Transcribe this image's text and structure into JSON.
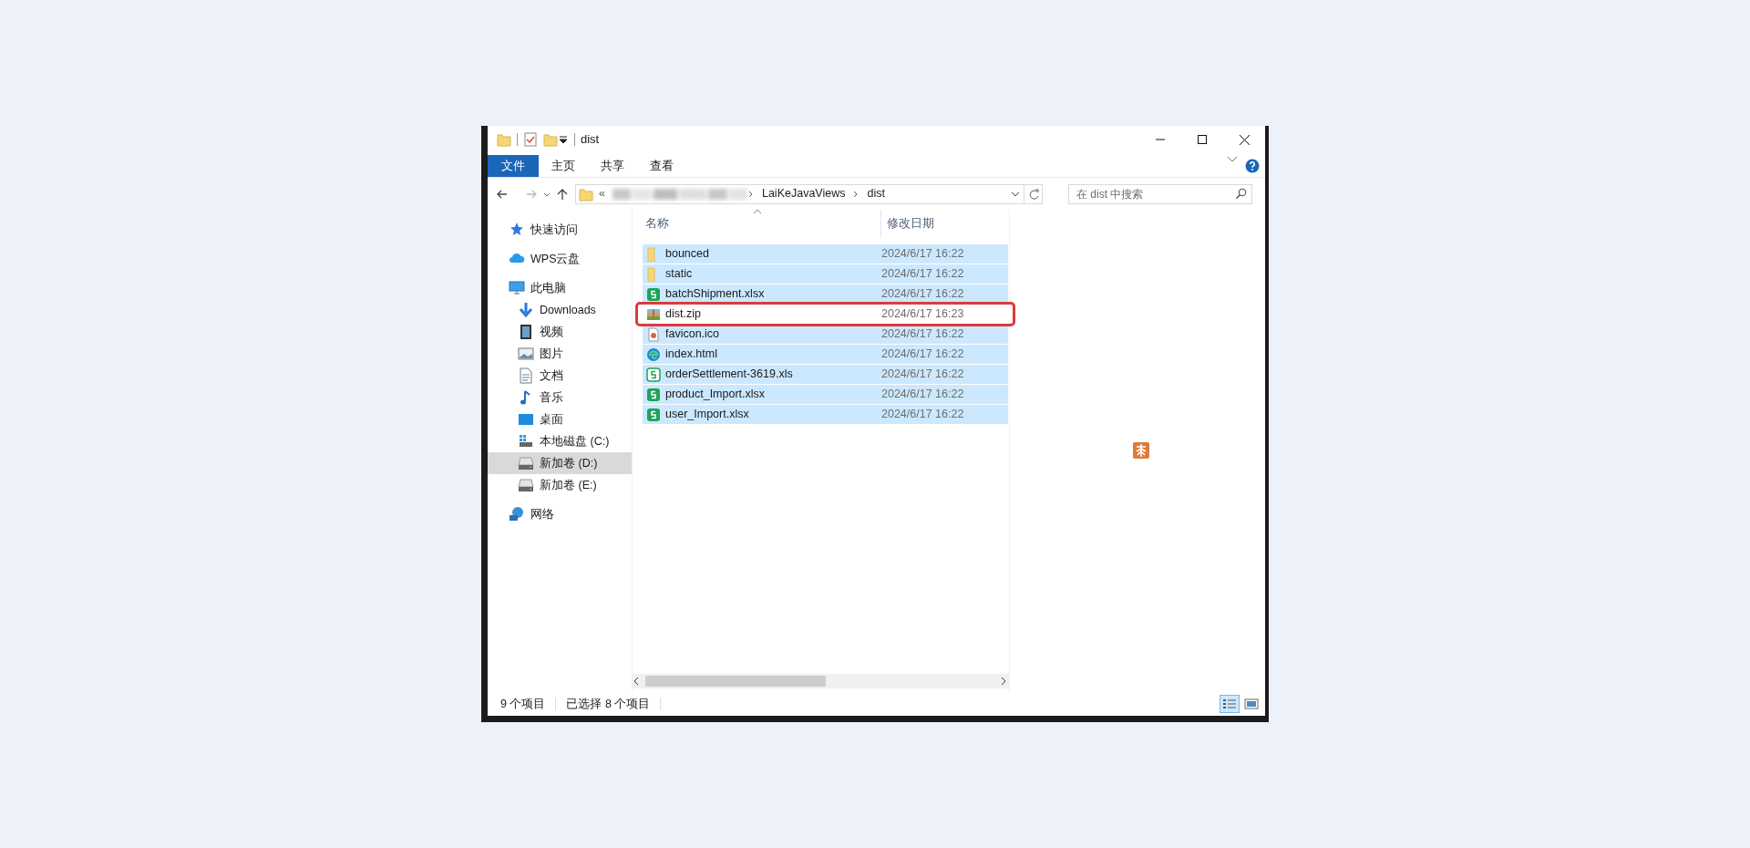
{
  "window": {
    "title": "dist"
  },
  "ribbon_tabs": [
    {
      "label": "文件",
      "kind": "file"
    },
    {
      "label": "主页",
      "kind": "tab"
    },
    {
      "label": "共享",
      "kind": "tab"
    },
    {
      "label": "查看",
      "kind": "tab"
    }
  ],
  "address": [
    {
      "kind": "overflow",
      "label": "«"
    },
    {
      "kind": "redacted"
    },
    {
      "kind": "folder",
      "label": "LaiKeJavaViews"
    },
    {
      "kind": "folder",
      "label": "dist"
    }
  ],
  "search": {
    "placeholder": "在 dist 中搜索"
  },
  "sidebar": {
    "items": [
      {
        "label": "快速访问",
        "kind": "star",
        "selected": false
      },
      {
        "label": "WPS云盘",
        "kind": "cloud",
        "selected": false
      },
      {
        "label": "此电脑",
        "kind": "pc",
        "selected": false,
        "children": [
          {
            "label": "Downloads",
            "kind": "download",
            "selected": false
          },
          {
            "label": "视频",
            "kind": "video",
            "selected": false
          },
          {
            "label": "图片",
            "kind": "picture",
            "selected": false
          },
          {
            "label": "文档",
            "kind": "doc",
            "selected": false
          },
          {
            "label": "音乐",
            "kind": "music",
            "selected": false
          },
          {
            "label": "桌面",
            "kind": "desktop",
            "selected": false
          },
          {
            "label": "本地磁盘 (C:)",
            "kind": "sysdrive",
            "selected": false
          },
          {
            "label": "新加卷 (D:)",
            "kind": "drive",
            "selected": true
          },
          {
            "label": "新加卷 (E:)",
            "kind": "drive",
            "selected": false
          }
        ]
      },
      {
        "label": "网络",
        "kind": "network",
        "selected": false
      }
    ]
  },
  "table": {
    "columns": [
      "名称",
      "修改日期"
    ],
    "rows": [
      {
        "name": "bounced",
        "date": "2024/6/17 16:22",
        "kind": "folder",
        "selected": true,
        "outlined": false
      },
      {
        "name": "static",
        "date": "2024/6/17 16:22",
        "kind": "folder",
        "selected": true,
        "outlined": false
      },
      {
        "name": "batchShipment.xlsx",
        "date": "2024/6/17 16:22",
        "kind": "sheet",
        "selected": true,
        "outlined": false
      },
      {
        "name": "dist.zip",
        "date": "2024/6/17 16:23",
        "kind": "zip",
        "selected": false,
        "outlined": true
      },
      {
        "name": "favicon.ico",
        "date": "2024/6/17 16:22",
        "kind": "image",
        "selected": true,
        "outlined": false
      },
      {
        "name": "index.html",
        "date": "2024/6/17 16:22",
        "kind": "web",
        "selected": true,
        "outlined": false
      },
      {
        "name": "orderSettlement-3619.xls",
        "date": "2024/6/17 16:22",
        "kind": "sheet-old",
        "selected": true,
        "outlined": false
      },
      {
        "name": "product_Import.xlsx",
        "date": "2024/6/17 16:22",
        "kind": "sheet",
        "selected": true,
        "outlined": false
      },
      {
        "name": "user_Import.xlsx",
        "date": "2024/6/17 16:22",
        "kind": "sheet",
        "selected": true,
        "outlined": false
      }
    ]
  },
  "status_bar": {
    "items": [
      "9 个项目",
      "已选择 8 个项目"
    ],
    "views": [
      {
        "kind": "details",
        "selected": true
      },
      {
        "kind": "tiles",
        "selected": false
      }
    ]
  }
}
